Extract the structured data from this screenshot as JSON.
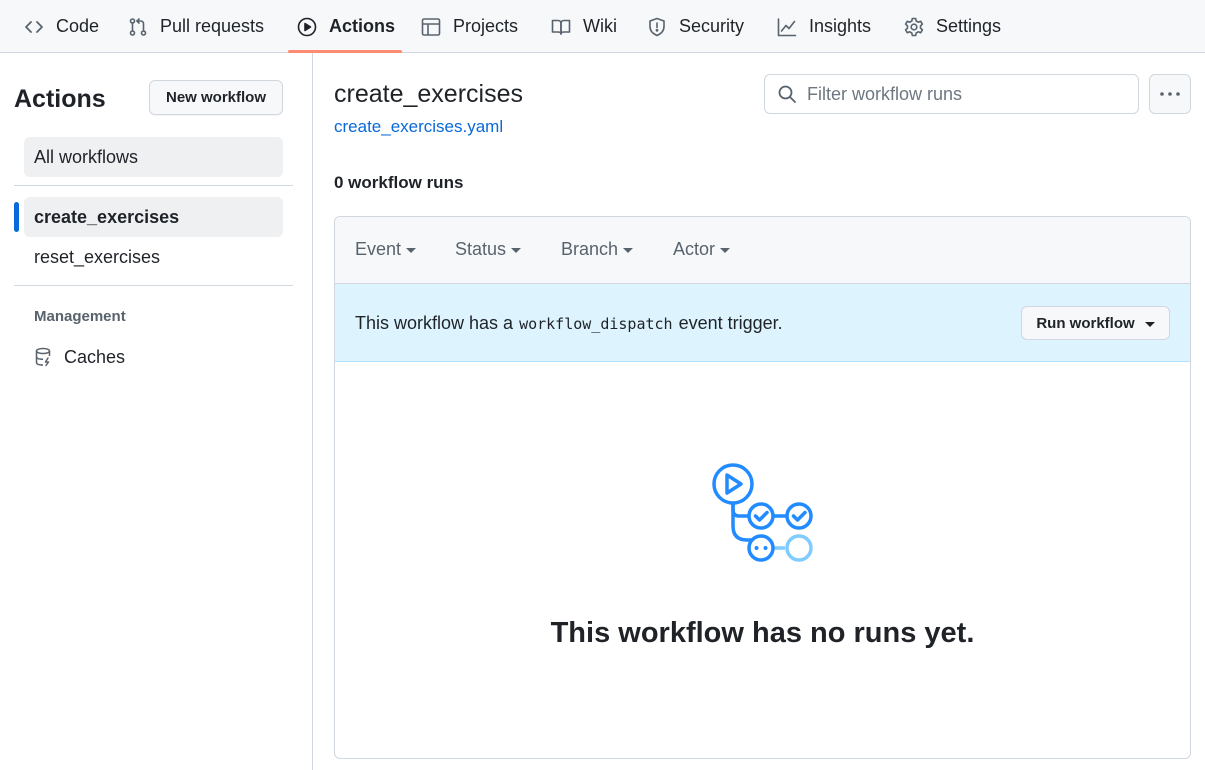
{
  "topnav": {
    "tabs": [
      {
        "label": "Code",
        "icon": "code-icon"
      },
      {
        "label": "Pull requests",
        "icon": "git-pull-request-icon"
      },
      {
        "label": "Actions",
        "icon": "play-icon",
        "active": true
      },
      {
        "label": "Projects",
        "icon": "table-icon"
      },
      {
        "label": "Wiki",
        "icon": "book-icon"
      },
      {
        "label": "Security",
        "icon": "shield-icon"
      },
      {
        "label": "Insights",
        "icon": "graph-icon"
      },
      {
        "label": "Settings",
        "icon": "gear-icon"
      }
    ],
    "active_underline_color": "#fd8c73"
  },
  "sidebar": {
    "title": "Actions",
    "new_workflow_label": "New workflow",
    "all_workflows_label": "All workflows",
    "workflows": [
      {
        "label": "create_exercises",
        "selected": true
      },
      {
        "label": "reset_exercises",
        "selected": false
      }
    ],
    "management_label": "Management",
    "caches_label": "Caches",
    "selected_color": "#0969da"
  },
  "main": {
    "workflow_title": "create_exercises",
    "workflow_file": "create_exercises.yaml",
    "search_placeholder": "Filter workflow runs",
    "runs_count": "0 workflow runs",
    "filters": [
      "Event",
      "Status",
      "Branch",
      "Actor"
    ],
    "dispatch": {
      "prefix": "This workflow has a",
      "code": "workflow_dispatch",
      "suffix": "event trigger."
    },
    "run_workflow_label": "Run workflow",
    "empty_message": "This workflow has no runs yet.",
    "accent_color": "#0969da",
    "banner_color": "#ddf4ff"
  }
}
